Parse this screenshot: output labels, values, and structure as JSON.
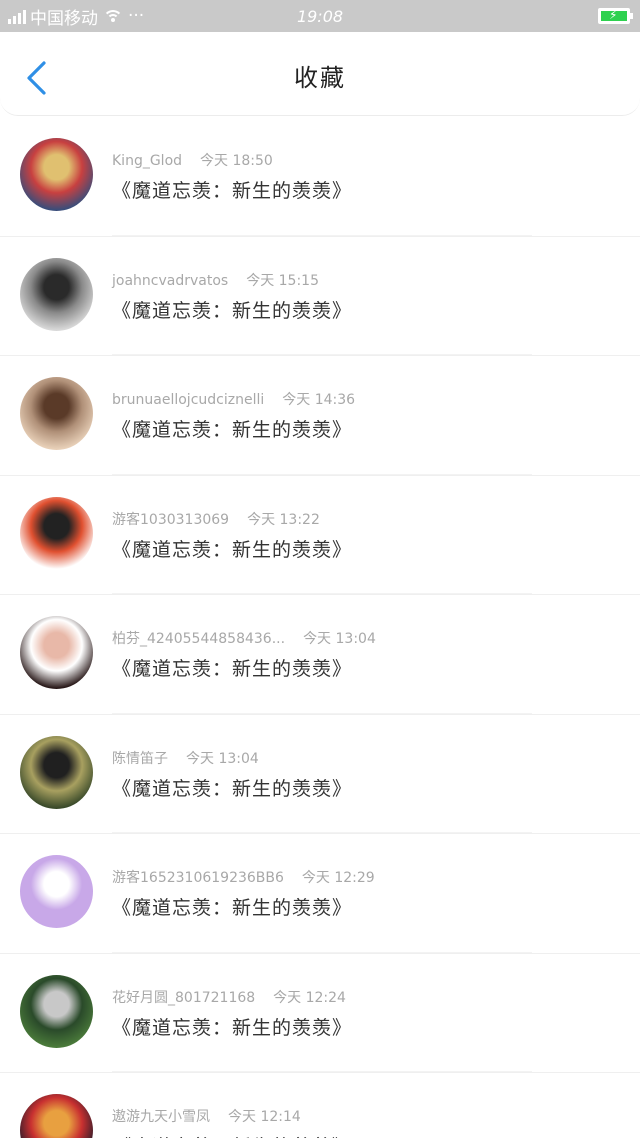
{
  "status_bar": {
    "carrier": "中国移动",
    "more": "···",
    "time": "19:08"
  },
  "header": {
    "back_icon": "chevron-left-icon",
    "title": "收藏"
  },
  "colors": {
    "accent": "#2f8fe6",
    "status_bar_bg": "#c9c9c9",
    "battery": "#2ed14f"
  },
  "items": [
    {
      "username": "King_Glod",
      "time": "今天 18:50",
      "title": "《魔道忘羡：新生的羡羡》",
      "avatar_colors": [
        "#3a4d7a",
        "#e0c070",
        "#c84040"
      ]
    },
    {
      "username": "joahncvadrvatos",
      "time": "今天 15:15",
      "title": "《魔道忘羡：新生的羡羡》",
      "avatar_colors": [
        "#d8d8d8",
        "#2a2a2a",
        "#8a8a8a"
      ]
    },
    {
      "username": "brunuaellojcudciznelli",
      "time": "今天 14:36",
      "title": "《魔道忘羡：新生的羡羡》",
      "avatar_colors": [
        "#e8d0b8",
        "#5a3a28",
        "#b09078"
      ]
    },
    {
      "username": "游客1030313069",
      "time": "今天 13:22",
      "title": "《魔道忘羡：新生的羡羡》",
      "avatar_colors": [
        "#ffffff",
        "#222222",
        "#e05030"
      ]
    },
    {
      "username": "柏芬_42405544858436...",
      "time": "今天 13:04",
      "title": "《魔道忘羡：新生的羡羡》",
      "avatar_colors": [
        "#2a1a1a",
        "#e8b8a8",
        "#ffffff"
      ]
    },
    {
      "username": "陈情笛子",
      "time": "今天 13:04",
      "title": "《魔道忘羡：新生的羡羡》",
      "avatar_colors": [
        "#3a4a2a",
        "#202020",
        "#a8a060"
      ]
    },
    {
      "username": "游客1652310619236BB6",
      "time": "今天 12:29",
      "title": "《魔道忘羡：新生的羡羡》",
      "avatar_colors": [
        "#c8a8e8",
        "#ffffff",
        "#c8a8e8"
      ]
    },
    {
      "username": "花好月圆_801721168",
      "time": "今天 12:24",
      "title": "《魔道忘羡：新生的羡羡》",
      "avatar_colors": [
        "#4a7a3a",
        "#c8c8c8",
        "#2a4a2a"
      ]
    },
    {
      "username": "遨游九天小雪凤",
      "time": "今天 12:14",
      "title": "《魔道忘羡：新生的羡羡》",
      "avatar_colors": [
        "#1a1a2a",
        "#e8a040",
        "#c83030"
      ]
    }
  ]
}
